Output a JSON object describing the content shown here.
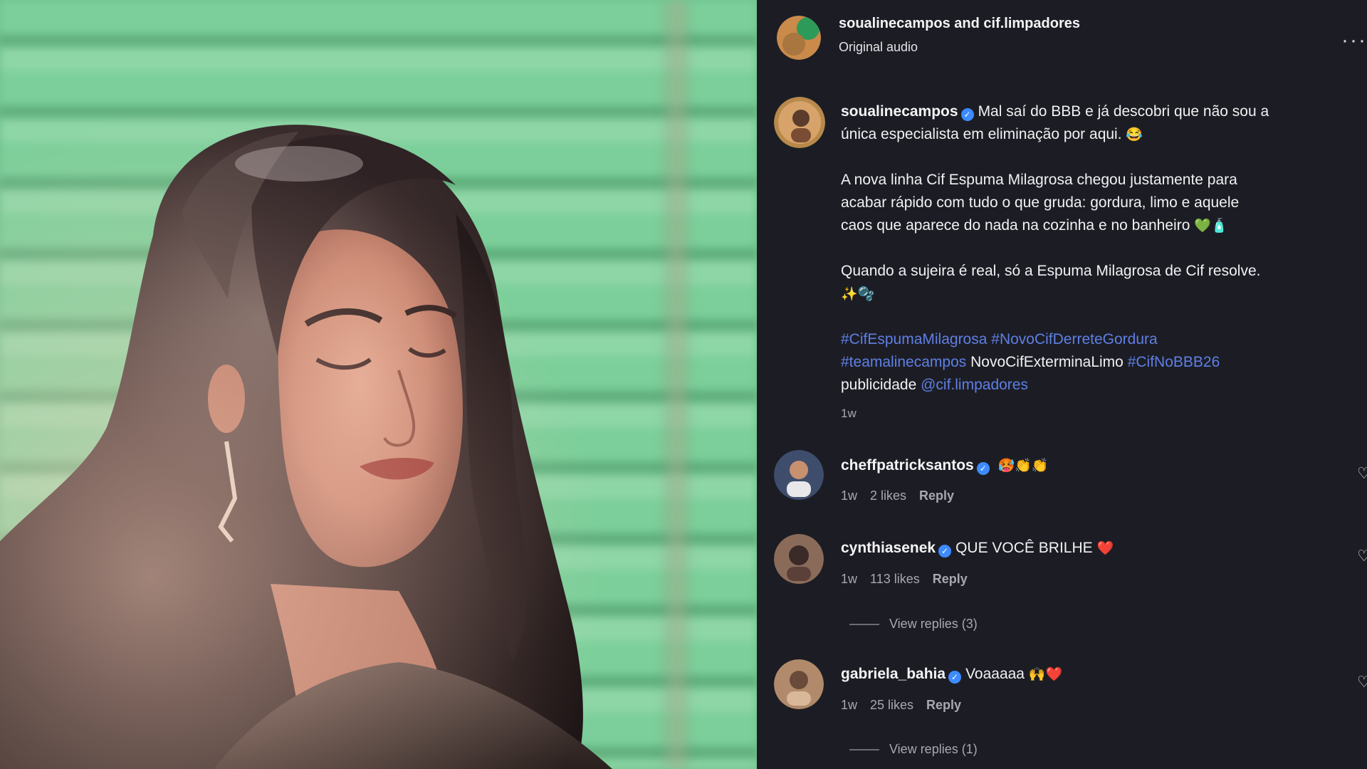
{
  "header": {
    "title": "soualinecampos and cif.limpadores",
    "subtitle": "Original audio",
    "more_icon": "more-horizontal-icon"
  },
  "caption": {
    "username": "soualinecampos",
    "line1": "Mal saí do BBB e já descobri que não sou a",
    "line2": "única especialista em eliminação por aqui.",
    "line2_emoji": "😂",
    "para2_line1": "A nova linha Cif Espuma Milagrosa chegou justamente para",
    "para2_line2": "acabar rápido com tudo o que gruda: gordura, limo e aquele",
    "para2_line3": "caos que aparece do nada na cozinha e no banheiro",
    "para2_emoji": "💚🧴",
    "para3_line1": "Quando a sujeira é real, só a Espuma Milagrosa de Cif resolve.",
    "para3_emoji": "✨🫧",
    "hashtag1": "#CifEspumaMilagrosa",
    "hashtag2": "#NovoCifDerreteGordura",
    "hashtag3": "#teamalinecampos",
    "plain_tag": "NovoCifExterminaLimo",
    "hashtag4": "#CifNoBBB26",
    "publicidade": "publicidade",
    "mention": "@cif.limpadores",
    "time": "1w"
  },
  "comments": [
    {
      "username": "cheffpatricksantos",
      "text": "",
      "emoji": "🥵👏👏",
      "time": "1w",
      "likes": "2 likes",
      "reply": "Reply"
    },
    {
      "username": "cynthiasenek",
      "text": "QUE VOCÊ BRILHE",
      "emoji": "❤️",
      "time": "1w",
      "likes": "113 likes",
      "reply": "Reply",
      "view_replies": "View replies (3)"
    },
    {
      "username": "gabriela_bahia",
      "text": "Voaaaaa",
      "emoji": "🙌❤️",
      "time": "1w",
      "likes": "25 likes",
      "reply": "Reply",
      "view_replies": "View replies (1)"
    }
  ],
  "colors": {
    "panel_bg": "#1c1d24",
    "text": "#f1f1f3",
    "muted": "#a7a8b0",
    "link": "#5f7fe6",
    "verified": "#3d8bff",
    "media_green": "#7ccf9a"
  }
}
